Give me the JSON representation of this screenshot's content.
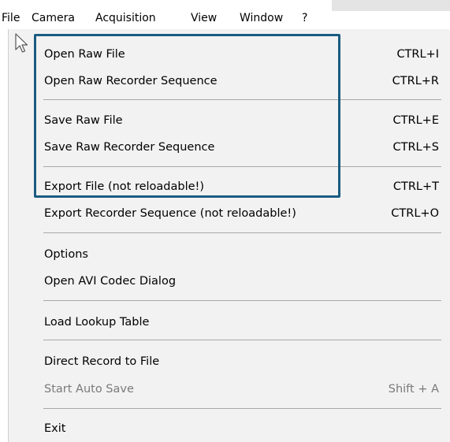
{
  "menubar": {
    "items": [
      "File",
      "Camera",
      "Acquisition",
      "View",
      "Window",
      "?"
    ]
  },
  "file_menu": {
    "items": [
      {
        "label": "Open Raw File",
        "shortcut": "CTRL+I"
      },
      {
        "label": "Open Raw Recorder Sequence",
        "shortcut": "CTRL+R"
      },
      {
        "label": "Save Raw File",
        "shortcut": "CTRL+E"
      },
      {
        "label": "Save Raw Recorder Sequence",
        "shortcut": "CTRL+S"
      },
      {
        "label": "Export File (not reloadable!)",
        "shortcut": "CTRL+T"
      },
      {
        "label": "Export Recorder Sequence (not reloadable!)",
        "shortcut": "CTRL+O"
      },
      {
        "label": "Options",
        "shortcut": ""
      },
      {
        "label": "Open AVI Codec Dialog",
        "shortcut": ""
      },
      {
        "label": "Load Lookup Table",
        "shortcut": ""
      },
      {
        "label": "Direct Record to File",
        "shortcut": ""
      },
      {
        "label": "Start Auto Save",
        "shortcut": "Shift + A",
        "disabled": true
      },
      {
        "label": "Exit",
        "shortcut": ""
      }
    ]
  },
  "colors": {
    "highlight_border": "#1a5c80",
    "menu_background": "#f2f2f2",
    "disabled_text": "#7a7a7a"
  }
}
